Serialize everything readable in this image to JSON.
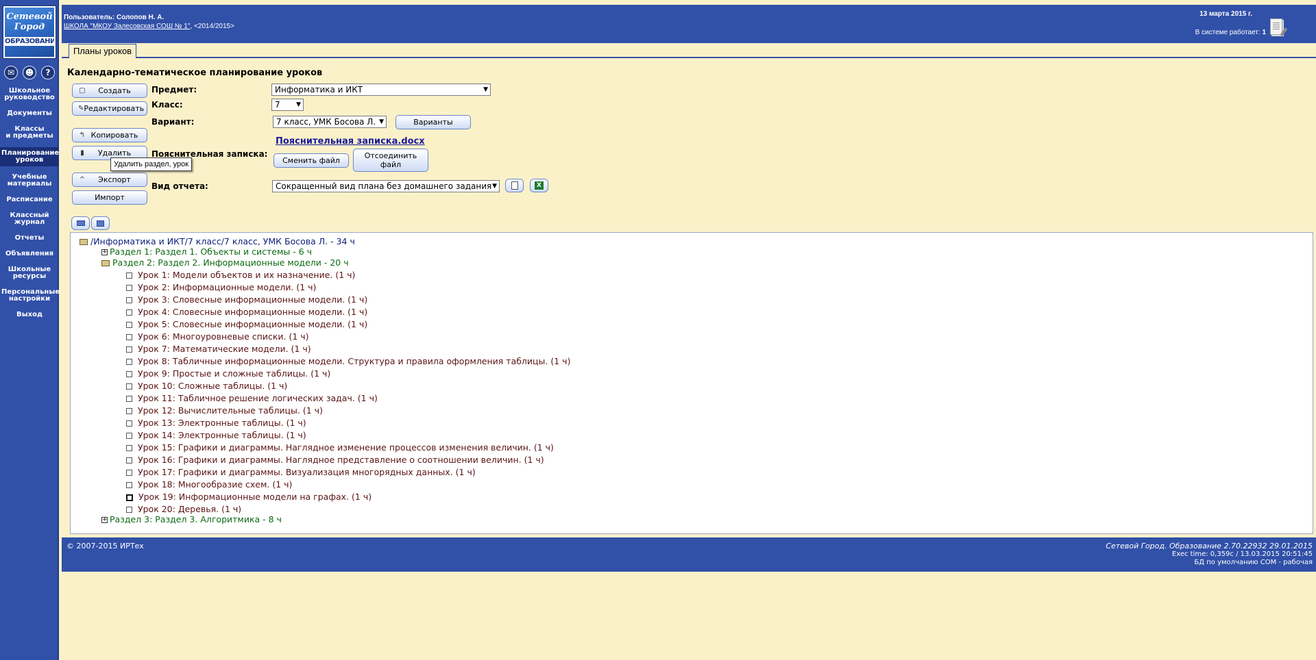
{
  "sidebar": {
    "logo": {
      "line1": "Сетевой",
      "line2": "Город",
      "line3": "ОБРАЗОВАНИЕ"
    },
    "icons": [
      "mail-icon",
      "users-icon",
      "help-icon"
    ],
    "items": [
      {
        "label": "Школьное\nруководство",
        "active": false
      },
      {
        "label": "Документы",
        "active": false
      },
      {
        "label": "Классы\nи предметы",
        "active": false
      },
      {
        "label": "Планирование\nуроков",
        "active": true
      },
      {
        "label": "Учебные\nматериалы",
        "active": false
      },
      {
        "label": "Расписание",
        "active": false
      },
      {
        "label": "Классный\nжурнал",
        "active": false
      },
      {
        "label": "Отчеты",
        "active": false
      },
      {
        "label": "Объявления",
        "active": false
      },
      {
        "label": "Школьные\nресурсы",
        "active": false
      },
      {
        "label": "Персональные\nнастройки",
        "active": false
      },
      {
        "label": "Выход",
        "active": false
      }
    ]
  },
  "header": {
    "user": "Пользователь: Солопов Н. А.",
    "school_link": "ШКОЛА \"МКОУ Залесовская СОШ № 1\"",
    "school_year": ",  <2014/2015>",
    "date": "13 марта 2015 г.",
    "online_label": "В системе работает:",
    "online_count": "1"
  },
  "tab": {
    "label": "Планы уроков"
  },
  "page": {
    "title": "Календарно-тематическое планирование уроков"
  },
  "actions": {
    "create": "Создать",
    "edit": "Редактировать",
    "copy": "Копировать",
    "delete": "Удалить",
    "export": "Экспорт",
    "import": "Импорт"
  },
  "tooltip": "Удалить раздел, урок",
  "form": {
    "subject_label": "Предмет:",
    "subject_value": "Информатика и ИКТ",
    "class_label": "Класс:",
    "class_value": "7",
    "variant_label": "Вариант:",
    "variant_value": "7 класс, УМК Босова Л.",
    "variants_button": "Варианты",
    "note_label": "Пояснительная записка:",
    "note_file": "Пояснительная записка.docx",
    "change_file": "Сменить файл",
    "detach_file": "Отсоединить\nфайл",
    "report_label": "Вид отчета:",
    "report_value": "Сокращенный вид плана без домашнего задания"
  },
  "tree": {
    "root": "/Информатика и ИКТ/7 класс/7 класс, УМК Босова Л. - 34 ч",
    "section1": "Раздел 1: Раздел 1. Объекты и системы - 6 ч",
    "section2": "Раздел 2: Раздел 2. Информационные модели - 20 ч",
    "lessons": [
      "Урок 1: Модели объектов и их назначение. (1 ч)",
      "Урок 2: Информационные модели. (1 ч)",
      "Урок 3: Словесные информационные модели. (1 ч)",
      "Урок 4: Словесные информационные модели. (1 ч)",
      "Урок 5: Словесные информационные модели. (1 ч)",
      "Урок 6: Многоуровневые списки. (1 ч)",
      "Урок 7: Математические модели. (1 ч)",
      "Урок 8: Табличные информационные модели. Структура и правила оформления таблицы. (1 ч)",
      "Урок 9: Простые и сложные таблицы. (1 ч)",
      "Урок 10: Сложные таблицы. (1 ч)",
      "Урок 11: Табличное решение логических задач. (1 ч)",
      "Урок 12: Вычислительные таблицы. (1 ч)",
      "Урок 13: Электронные таблицы. (1 ч)",
      "Урок 14: Электронные таблицы. (1 ч)",
      "Урок 15: Графики и диаграммы. Наглядное изменение процессов изменения величин. (1 ч)",
      "Урок 16: Графики и диаграммы. Наглядное представление о соотношении величин. (1 ч)",
      "Урок 17: Графики и диаграммы. Визуализация многорядных данных. (1 ч)",
      "Урок 18: Многообразие схем. (1 ч)",
      "Урок 19: Информационные модели на графах. (1 ч)",
      "Урок 20: Деревья. (1 ч)"
    ],
    "section3": "Раздел 3: Раздел 3. Алгоритмика - 8 ч"
  },
  "footer": {
    "copyright": "© 2007-2015 ИРТех",
    "version": "Сетевой Город. Образование 2.70.22932   29.01.2015",
    "exec": "Exec time: 0,359c / 13.03.2015 20:51:45",
    "db": "БД по умолчанию COM - рабочая"
  },
  "colors": {
    "brand_blue": "#3150a8",
    "page_bg": "#fbf1c9",
    "section_green": "#0c6a12",
    "lesson_red": "#5b1414"
  }
}
